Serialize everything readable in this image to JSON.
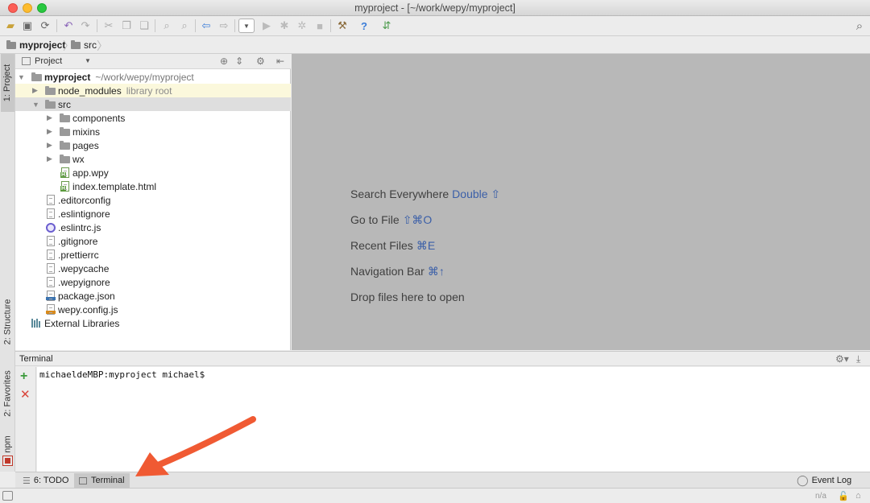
{
  "window": {
    "title": "myproject - [~/work/wepy/myproject]"
  },
  "navbar": {
    "crumbs": [
      "myproject",
      "src"
    ]
  },
  "left_strip": {
    "project_tab": "1: Project",
    "structure_tab": "2: Structure",
    "favorites_tab": "2: Favorites",
    "npm_tab": "npm"
  },
  "project_panel": {
    "view_selector": "Project",
    "tree": [
      {
        "label": "myproject",
        "path": "~/work/wepy/myproject"
      },
      {
        "label": "node_modules",
        "hint": "library root"
      },
      {
        "label": "src"
      },
      {
        "label": "components"
      },
      {
        "label": "mixins"
      },
      {
        "label": "pages"
      },
      {
        "label": "wx"
      },
      {
        "label": "app.wpy"
      },
      {
        "label": "index.template.html"
      },
      {
        "label": ".editorconfig"
      },
      {
        "label": ".eslintignore"
      },
      {
        "label": ".eslintrc.js"
      },
      {
        "label": ".gitignore"
      },
      {
        "label": ".prettierrc"
      },
      {
        "label": ".wepycache"
      },
      {
        "label": ".wepyignore"
      },
      {
        "label": "package.json"
      },
      {
        "label": "wepy.config.js"
      },
      {
        "label": "External Libraries"
      }
    ]
  },
  "editor": {
    "hints": [
      {
        "text": "Search Everywhere",
        "key": "Double ⇧"
      },
      {
        "text": "Go to File",
        "key": "⇧⌘O"
      },
      {
        "text": "Recent Files",
        "key": "⌘E"
      },
      {
        "text": "Navigation Bar",
        "key": "⌘↑"
      },
      {
        "text": "Drop files here to open",
        "key": ""
      }
    ]
  },
  "terminal": {
    "title": "Terminal",
    "prompt": "michaeldeMBP:myproject michael$"
  },
  "bottom_bar": {
    "todo_tab": "6: TODO",
    "terminal_tab": "Terminal",
    "event_log": "Event Log"
  },
  "status_bar": {
    "position": "n/a"
  },
  "colors": {
    "accent_key": "#3b5fa8",
    "annotation_arrow": "#f05a33"
  }
}
